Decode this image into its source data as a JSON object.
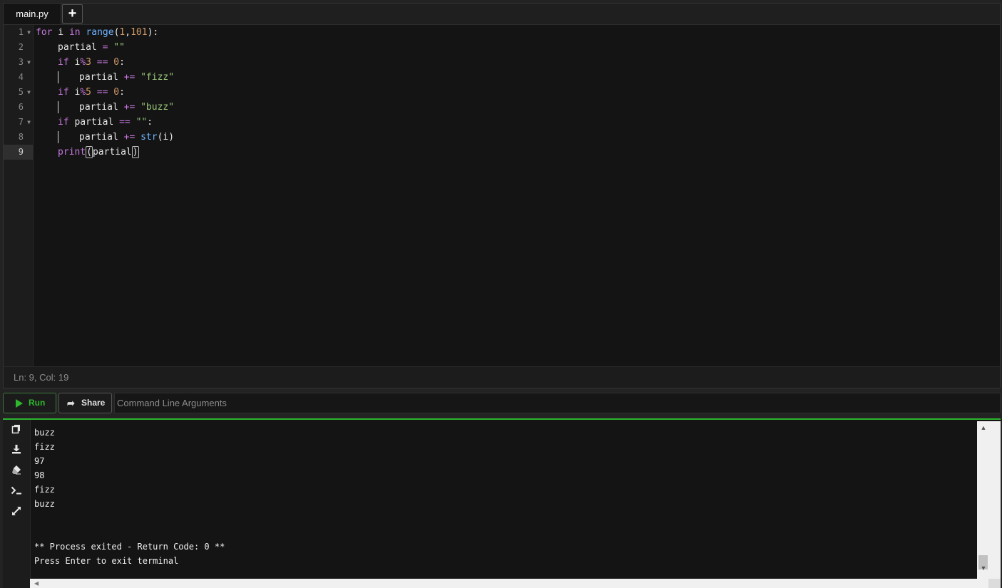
{
  "editor": {
    "tabs": [
      {
        "label": "main.py"
      }
    ],
    "add_tab_label": "+",
    "line_numbers": [
      "1",
      "2",
      "3",
      "4",
      "5",
      "6",
      "7",
      "8",
      "9"
    ],
    "active_line": "9",
    "code": {
      "l1": {
        "kw1": "for",
        "t1": " i ",
        "kw2": "in",
        "t2": " ",
        "fn": "range",
        "p1": "(",
        "n1": "1",
        "c": ",",
        "n2": "101",
        "p2": "):"
      },
      "l2": {
        "t1": "partial ",
        "op": "=",
        "t2": " ",
        "s": "\"\""
      },
      "l3": {
        "kw": "if",
        "t1": " i",
        "op1": "%",
        "n1": "3",
        "t2": " ",
        "op2": "==",
        "t3": " ",
        "n2": "0",
        "t4": ":"
      },
      "l4": {
        "t1": "partial ",
        "op": "+=",
        "t2": " ",
        "s": "\"fizz\""
      },
      "l5": {
        "kw": "if",
        "t1": " i",
        "op1": "%",
        "n1": "5",
        "t2": " ",
        "op2": "==",
        "t3": " ",
        "n2": "0",
        "t4": ":"
      },
      "l6": {
        "t1": "partial ",
        "op": "+=",
        "t2": " ",
        "s": "\"buzz\""
      },
      "l7": {
        "kw": "if",
        "t1": " partial ",
        "op": "==",
        "t2": " ",
        "s": "\"\"",
        "t3": ":"
      },
      "l8": {
        "t1": "partial ",
        "op": "+=",
        "t2": " ",
        "fn": "str",
        "t3": "(i)"
      },
      "l9": {
        "fn": "print",
        "p1": "(",
        "t1": "partial",
        "p2": ")"
      }
    },
    "status": "Ln: 9,  Col: 19"
  },
  "toolbar": {
    "run_label": "Run",
    "share_label": "Share",
    "args_placeholder": "Command Line Arguments"
  },
  "terminal": {
    "tools": [
      "copy-icon",
      "download-icon",
      "eraser-icon",
      "terminal-icon",
      "expand-icon"
    ],
    "lines": [
      "buzz",
      "fizz",
      "97",
      "98",
      "fizz",
      "buzz",
      "",
      "",
      "** Process exited - Return Code: 0 **",
      "Press Enter to exit terminal"
    ]
  },
  "colors": {
    "accent_green": "#2eb82e",
    "keyword": "#c678dd",
    "function": "#6fb3ff",
    "number": "#d19a66",
    "string": "#98c379"
  }
}
